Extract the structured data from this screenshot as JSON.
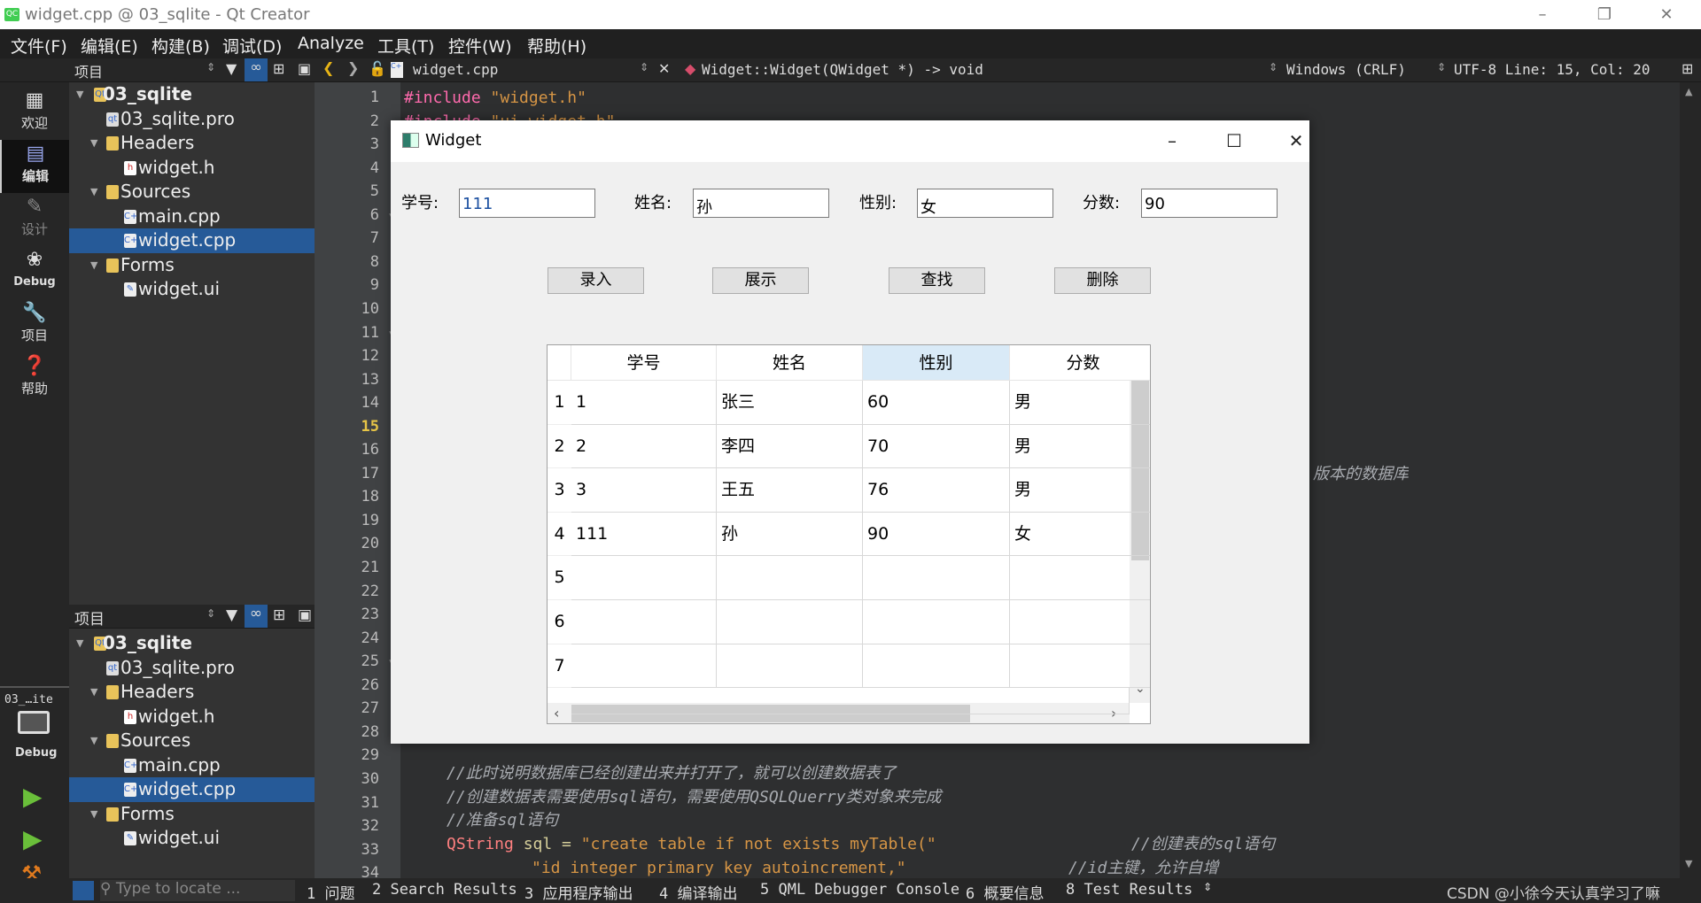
{
  "window": {
    "title": "widget.cpp @ 03_sqlite - Qt Creator",
    "app_icon": "QC"
  },
  "menu": [
    "文件(F)",
    "编辑(E)",
    "构建(B)",
    "调试(D)",
    "Analyze",
    "工具(T)",
    "控件(W)",
    "帮助(H)"
  ],
  "toolbar": {
    "panel_title": "项目",
    "file": "widget.cpp",
    "function": "Widget::Widget(QWidget *) -> void",
    "line_ending": "Windows (CRLF)",
    "encoding_pos": "UTF-8 Line: 15, Col: 20"
  },
  "modes": [
    "欢迎",
    "编辑",
    "设计",
    "Debug",
    "项目",
    "帮助"
  ],
  "project_tree": [
    {
      "label": "03_sqlite",
      "type": "project"
    },
    {
      "label": "03_sqlite.pro",
      "type": "pro"
    },
    {
      "label": "Headers",
      "type": "folder"
    },
    {
      "label": "widget.h",
      "type": "h"
    },
    {
      "label": "Sources",
      "type": "folder"
    },
    {
      "label": "main.cpp",
      "type": "cpp"
    },
    {
      "label": "widget.cpp",
      "type": "cpp",
      "selected": true
    },
    {
      "label": "Forms",
      "type": "folder"
    },
    {
      "label": "widget.ui",
      "type": "ui"
    }
  ],
  "kit": {
    "project": "03_…ite",
    "config": "Debug"
  },
  "editor": {
    "current_line": 15,
    "line_numbers": [
      1,
      2,
      3,
      4,
      5,
      6,
      7,
      8,
      9,
      10,
      11,
      12,
      13,
      14,
      15,
      16,
      17,
      18,
      19,
      20,
      21,
      22,
      23,
      24,
      25,
      26,
      27,
      28,
      29,
      30,
      31,
      32,
      33,
      34
    ],
    "line1": {
      "kw": "#include",
      "str": " \"widget.h\""
    },
    "line2": {
      "kw": "#include",
      "str": " \"ui_widget.h\""
    },
    "line17_tail": "版本的数据库",
    "line30": "//此时说明数据库已经创建出来并打开了，就可以创建数据表了",
    "line31": "//创建数据表需要使用sql语句，需要使用QSQLQuerry类对象来完成",
    "line32": "//准备sql语句",
    "line33": {
      "type": "QString",
      "code": " sql = ",
      "str": "\"create table if not exists myTable(\"",
      "comment": "//创建表的sql语句"
    },
    "line34": {
      "str": "\"id integer primary key autoincrement,\"",
      "comment": "//id主键，允许自增"
    }
  },
  "statusbar": {
    "locate_placeholder": "Type to locate ...",
    "items": [
      "1 问题",
      "2 Search Results",
      "3 应用程序输出",
      "4 编译输出",
      "5 QML Debugger Console",
      "6 概要信息",
      "8 Test Results"
    ],
    "watermark": "CSDN @小徐今天认真学习了嘛"
  },
  "widget": {
    "title": "Widget",
    "fields": [
      {
        "label": "学号:",
        "value": "111"
      },
      {
        "label": "姓名:",
        "value": "孙"
      },
      {
        "label": "性别:",
        "value": "女"
      },
      {
        "label": "分数:",
        "value": "90"
      }
    ],
    "buttons": [
      "录入",
      "展示",
      "查找",
      "删除"
    ],
    "table": {
      "headers": [
        "学号",
        "姓名",
        "性别",
        "分数"
      ],
      "selected_header": 2,
      "row_headers": [
        "1",
        "2",
        "3",
        "4",
        "5",
        "6",
        "7"
      ],
      "rows": [
        [
          "1",
          "张三",
          "60",
          "男"
        ],
        [
          "2",
          "李四",
          "70",
          "男"
        ],
        [
          "3",
          "王五",
          "76",
          "男"
        ],
        [
          "111",
          "孙",
          "90",
          "女"
        ],
        [
          "",
          "",
          "",
          ""
        ],
        [
          "",
          "",
          "",
          ""
        ],
        [
          "",
          "",
          "",
          ""
        ]
      ]
    }
  }
}
